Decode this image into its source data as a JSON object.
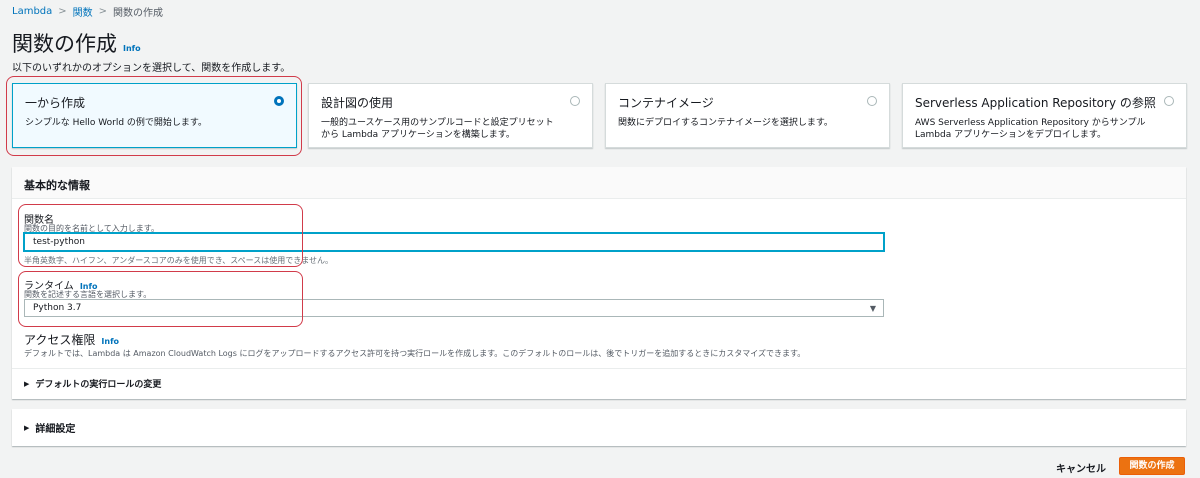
{
  "breadcrumb": [
    "Lambda",
    "関数",
    "関数の作成"
  ],
  "page": {
    "title": "関数の作成",
    "info": "Info",
    "description": "以下のいずれかのオプションを選択して、関数を作成します。"
  },
  "options": [
    {
      "title": "一から作成",
      "desc": "シンプルな Hello World の例で開始します。",
      "selected": true
    },
    {
      "title": "設計図の使用",
      "desc": "一般的ユースケース用のサンプルコードと設定プリセットから Lambda アプリケーションを構築します。",
      "selected": false
    },
    {
      "title": "コンテナイメージ",
      "desc": "関数にデプロイするコンテナイメージを選択します。",
      "selected": false
    },
    {
      "title": "Serverless Application Repository の参照",
      "desc": "AWS Serverless Application Repository からサンプル Lambda アプリケーションをデプロイします。",
      "selected": false
    }
  ],
  "basic": {
    "header": "基本的な情報",
    "function_name": {
      "label": "関数名",
      "desc": "関数の目的を名前として入力します。",
      "value": "test-python",
      "constraint": "半角英数字、ハイフン、アンダースコアのみを使用でき、スペースは使用できません。"
    },
    "runtime": {
      "label": "ランタイム",
      "info": "Info",
      "desc": "関数を記述する言語を選択します。",
      "value": "Python 3.7"
    },
    "access": {
      "title": "アクセス権限",
      "info": "Info",
      "desc": "デフォルトでは、Lambda は Amazon CloudWatch Logs にログをアップロードするアクセス許可を持つ実行ロールを作成します。このデフォルトのロールは、後でトリガーを追加するときにカスタマイズできます。",
      "expander": "デフォルトの実行ロールの変更"
    }
  },
  "advanced": {
    "label": "詳細設定"
  },
  "footer": {
    "cancel": "キャンセル",
    "create": "関数の作成"
  },
  "icons": {
    "expand": "▶",
    "caret": "▼"
  },
  "colors": {
    "accent": "#0073bb",
    "primary_button": "#ec7211",
    "highlight": "#d13b4a"
  }
}
